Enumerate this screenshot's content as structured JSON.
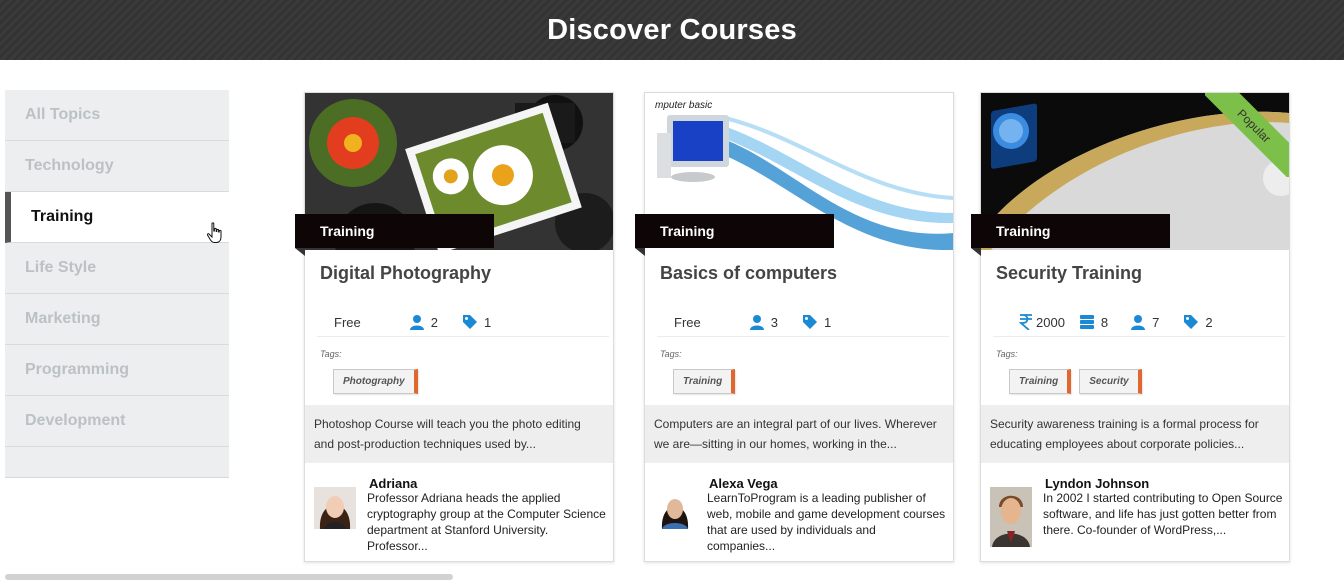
{
  "header": {
    "title": "Discover Courses"
  },
  "sidebar": {
    "items": [
      {
        "label": "All Topics",
        "active": false
      },
      {
        "label": "Technology",
        "active": false
      },
      {
        "label": "Training",
        "active": true
      },
      {
        "label": "Life Style",
        "active": false
      },
      {
        "label": "Marketing",
        "active": false
      },
      {
        "label": "Programming",
        "active": false
      },
      {
        "label": "Development",
        "active": false
      }
    ]
  },
  "courses": [
    {
      "category": "Training",
      "title": "Digital Photography",
      "price": "Free",
      "students": "2",
      "tag_count": "1",
      "tags_label": "Tags:",
      "tags": [
        "Photography"
      ],
      "description": "Photoshop Course will teach you the photo editing and post-production techniques used by...",
      "author_name": "Adriana",
      "author_bio": "Professor Adriana heads the applied cryptography group at the Computer Science department at Stanford University. Professor..."
    },
    {
      "category": "Training",
      "title": "Basics of computers",
      "price": "Free",
      "students": "3",
      "tag_count": "1",
      "tags_label": "Tags:",
      "tags": [
        "Training"
      ],
      "description": "Computers are an integral part of our lives. Wherever we are—sitting in our homes, working in the...",
      "author_name": "Alexa Vega",
      "author_bio": "LearnToProgram is a leading publisher of web, mobile and game development courses that are used by individuals and companies...",
      "image_caption": "mputer basic"
    },
    {
      "category": "Training",
      "title": "Security Training",
      "price": "2000",
      "lessons": "8",
      "students": "7",
      "tag_count": "2",
      "tags_label": "Tags:",
      "tags": [
        "Training",
        "Security"
      ],
      "description": "Security awareness training is a formal process for educating employees about corporate policies...",
      "author_name": "Lyndon Johnson",
      "author_bio": "In 2002 I started contributing to Open Source software, and life has just gotten better from there. Co-founder of WordPress,...",
      "badge": "Popular"
    }
  ],
  "colors": {
    "accent_orange": "#e0682e",
    "ribbon": "#0d0506",
    "icon_blue": "#1a8ad4",
    "popular_green": "#7cc04a"
  },
  "icons": {
    "students": "user-icon",
    "tags": "tag-icon",
    "lessons": "stack-icon",
    "price": "rupee-icon",
    "cursor": "hand-cursor-icon"
  }
}
